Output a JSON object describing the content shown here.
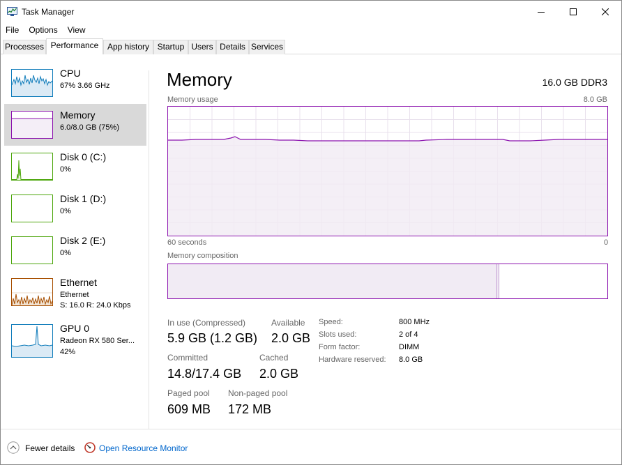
{
  "window": {
    "title": "Task Manager",
    "app_icon": "task-manager-icon"
  },
  "menu": [
    "File",
    "Options",
    "View"
  ],
  "tabs": [
    {
      "label": "Processes"
    },
    {
      "label": "Performance",
      "active": true
    },
    {
      "label": "App history"
    },
    {
      "label": "Startup"
    },
    {
      "label": "Users"
    },
    {
      "label": "Details"
    },
    {
      "label": "Services"
    }
  ],
  "sidebar": {
    "items": [
      {
        "title": "CPU",
        "sub1": "67% 3.66 GHz",
        "color": "#117dbb"
      },
      {
        "title": "Memory",
        "sub1": "6.0/8.0 GB (75%)",
        "color": "#8b12ae",
        "selected": true
      },
      {
        "title": "Disk 0 (C:)",
        "sub1": "0%",
        "color": "#4da60c"
      },
      {
        "title": "Disk 1 (D:)",
        "sub1": "0%",
        "color": "#4da60c"
      },
      {
        "title": "Disk 2 (E:)",
        "sub1": "0%",
        "color": "#4da60c"
      },
      {
        "title": "Ethernet",
        "sub1": "Ethernet",
        "sub2": "S: 16.0 R: 24.0 Kbps",
        "color": "#a74f01"
      },
      {
        "title": "GPU 0",
        "sub1": "Radeon RX 580 Ser...",
        "sub2": "42%",
        "color": "#117dbb"
      }
    ]
  },
  "main": {
    "title": "Memory",
    "total": "16.0 GB DDR3",
    "usage_label": "Memory usage",
    "usage_max": "8.0 GB",
    "time_left": "60 seconds",
    "time_right": "0",
    "composition_label": "Memory composition",
    "in_use_fraction": 0.75,
    "stats": {
      "in_use_label": "In use (Compressed)",
      "in_use_value": "5.9 GB (1.2 GB)",
      "available_label": "Available",
      "available_value": "2.0 GB",
      "committed_label": "Committed",
      "committed_value": "14.8/17.4 GB",
      "cached_label": "Cached",
      "cached_value": "2.0 GB",
      "paged_label": "Paged pool",
      "paged_value": "609 MB",
      "nonpaged_label": "Non-paged pool",
      "nonpaged_value": "172 MB"
    },
    "specs": [
      {
        "label": "Speed:",
        "value": "800 MHz"
      },
      {
        "label": "Slots used:",
        "value": "2 of 4"
      },
      {
        "label": "Form factor:",
        "value": "DIMM"
      },
      {
        "label": "Hardware reserved:",
        "value": "8.0 GB"
      }
    ]
  },
  "footer": {
    "fewer_details": "Fewer details",
    "open_monitor": "Open Resource Monitor"
  }
}
